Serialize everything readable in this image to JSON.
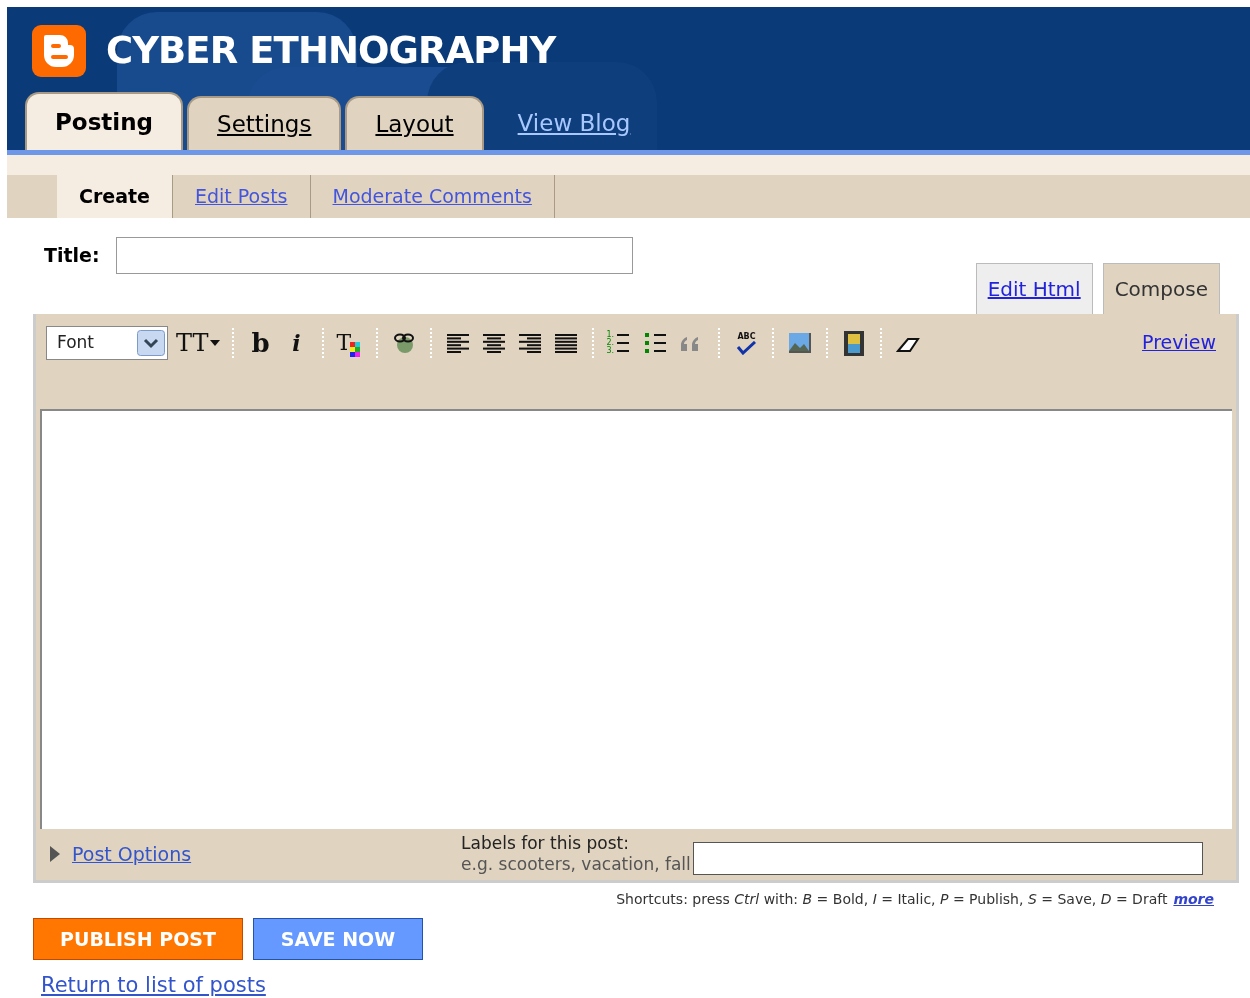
{
  "header": {
    "blog_title": "CYBER ETHNOGRAPHY"
  },
  "tabs": [
    {
      "label": "Posting",
      "kind": "tab",
      "selected": true
    },
    {
      "label": "Settings",
      "kind": "tab",
      "selected": false
    },
    {
      "label": "Layout",
      "kind": "tab",
      "selected": false
    },
    {
      "label": "View Blog",
      "kind": "link",
      "selected": false
    }
  ],
  "subtabs": [
    {
      "label": "Create",
      "selected": true
    },
    {
      "label": "Edit Posts",
      "selected": false
    },
    {
      "label": "Moderate Comments",
      "selected": false
    }
  ],
  "title_field": {
    "label": "Title:"
  },
  "editor_tabs": [
    {
      "label": "Edit Html",
      "selected": false
    },
    {
      "label": "Compose",
      "selected": true
    }
  ],
  "toolbar": {
    "font": "Font",
    "preview": "Preview",
    "font_size_glyph": "TT",
    "bold_glyph": "b",
    "italic_glyph": "i",
    "text_color_glyph": "T",
    "number_glyphs": [
      "1.",
      "2.",
      "3."
    ],
    "spellcheck_glyph": "ABC"
  },
  "post_options": {
    "label": "Post Options",
    "expanded": false
  },
  "labels": {
    "label": "Labels for this post:",
    "hint": "e.g. scooters, vacation, fall"
  },
  "shortcuts": {
    "text": "Shortcuts: press *Ctrl* with: *B* = Bold, *I* = Italic, *P* = Publish, *S* = Save, *D* = Draft",
    "more": "more"
  },
  "buttons": [
    {
      "label": "PUBLISH POST",
      "kind": "primary"
    },
    {
      "label": "SAVE NOW",
      "kind": "secondary"
    }
  ],
  "return_link": "Return to list of posts"
}
